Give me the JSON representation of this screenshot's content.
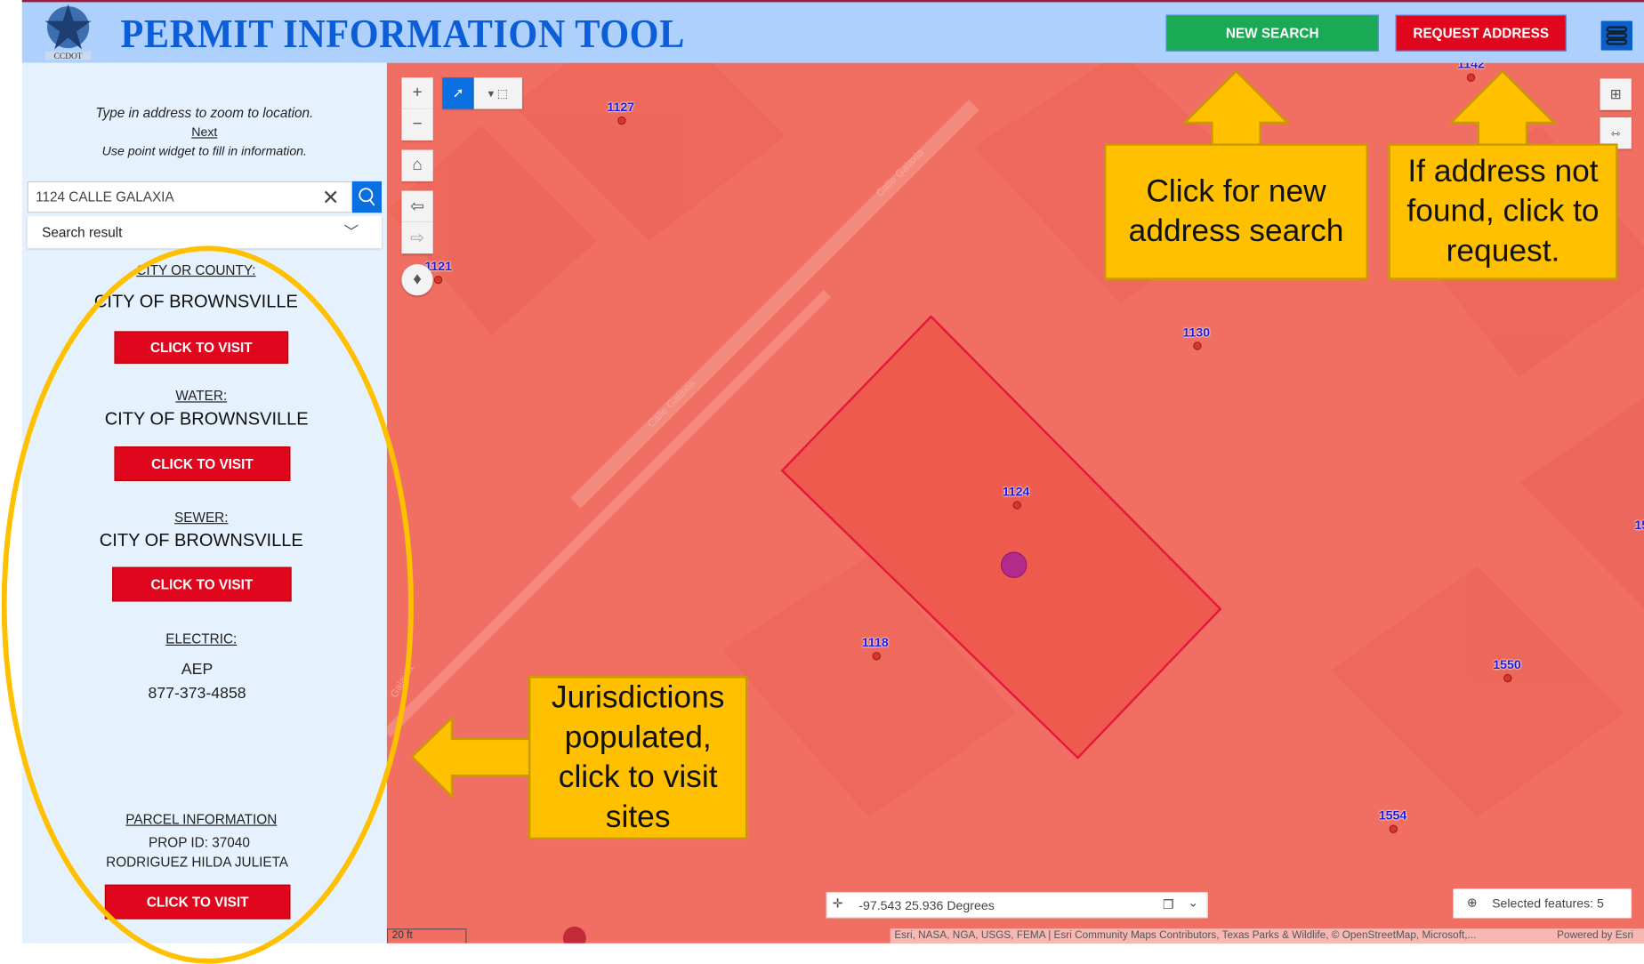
{
  "header": {
    "logo_text": "CCDOT",
    "title": "PERMIT INFORMATION TOOL",
    "new_search": "NEW SEARCH",
    "request_address": "REQUEST ADDRESS",
    "colors": {
      "new_search": "#1aaa55",
      "request_address": "#e0061e",
      "title": "#0b5ed8"
    }
  },
  "sidebar": {
    "instruction1": "Type in address to zoom to location.",
    "next": "Next",
    "instruction2": "Use point widget to fill in information.",
    "search": {
      "value": "1124 CALLE GALAXIA",
      "result_select": "Search result"
    },
    "city_label": "CITY OR COUNTY:",
    "city_value": "CITY OF BROWNSVILLE",
    "water_label": "WATER:",
    "water_value": "CITY OF BROWNSVILLE",
    "sewer_label": "SEWER:",
    "sewer_value": "CITY OF BROWNSVILLE",
    "electric_label": "ELECTRIC:",
    "electric_value": "AEP",
    "electric_phone": "877-373-4858",
    "parcel_label": "PARCEL INFORMATION",
    "prop_id": "PROP ID: 37040",
    "owner": "RODRIGUEZ HILDA JULIETA",
    "visit_label": "CLICK TO VISIT"
  },
  "map": {
    "streets": [
      "Calle Galaxia",
      "Calle Galaxia",
      "Galaxia"
    ],
    "parcels": [
      "1127",
      "1121",
      "1130",
      "1124",
      "1118",
      "1550",
      "1554",
      "1142",
      "15"
    ],
    "coordinates": "-97.543 25.936 Degrees",
    "selected": "Selected features: 5",
    "scale": "20 ft",
    "attribution": "Esri, NASA, NGA, USGS, FEMA | Esri Community Maps Contributors, Texas Parks & Wildlife, © OpenStreetMap, Microsoft,...",
    "powered": "Powered by Esri"
  },
  "callouts": {
    "new_search": "Click for new address search",
    "request": "If address not found, click to request.",
    "jurisdictions": "Jurisdictions populated, click to visit sites",
    "color": "#ffc000"
  }
}
